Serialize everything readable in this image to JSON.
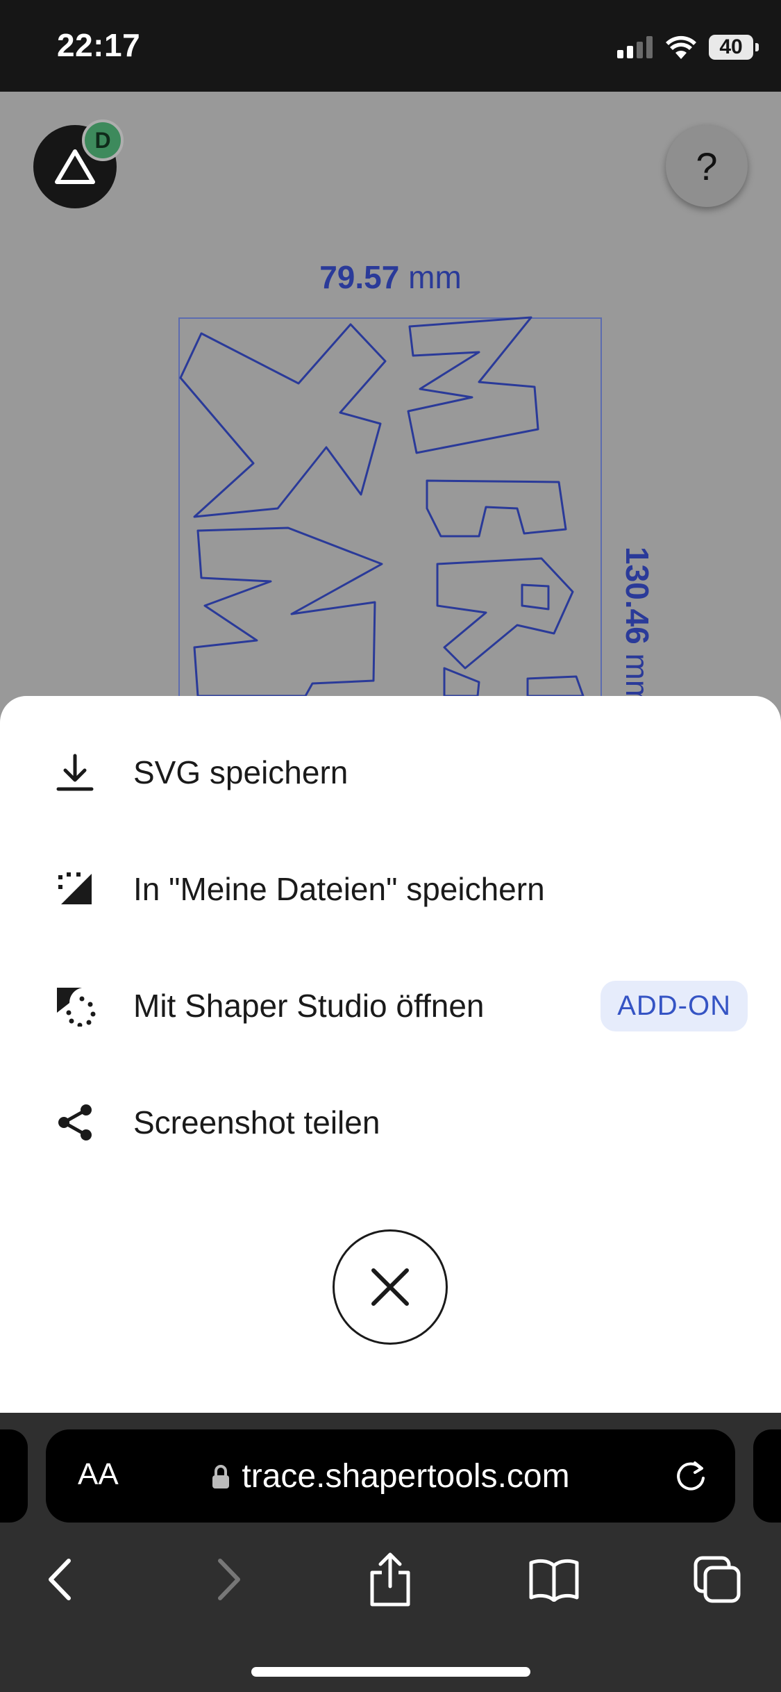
{
  "status_bar": {
    "time": "22:17",
    "battery": "40"
  },
  "canvas": {
    "avatar_initial": "D",
    "help_label": "?",
    "width_value": "79.57",
    "width_unit": "mm",
    "height_value": "130.46",
    "height_unit": "mm",
    "colors": {
      "trace": "#2a3a99",
      "background": "#999999"
    }
  },
  "sheet": {
    "items": [
      {
        "label": "SVG speichern",
        "icon": "download-icon"
      },
      {
        "label": "In \"Meine Dateien\" speichern",
        "icon": "save-to-files-icon"
      },
      {
        "label": "Mit Shaper Studio öffnen",
        "icon": "shaper-studio-icon",
        "badge": "ADD-ON"
      },
      {
        "label": "Screenshot teilen",
        "icon": "share-icon"
      }
    ],
    "close_icon": "close-icon"
  },
  "browser": {
    "text_size_label": "AA",
    "url": "trace.shapertools.com"
  }
}
